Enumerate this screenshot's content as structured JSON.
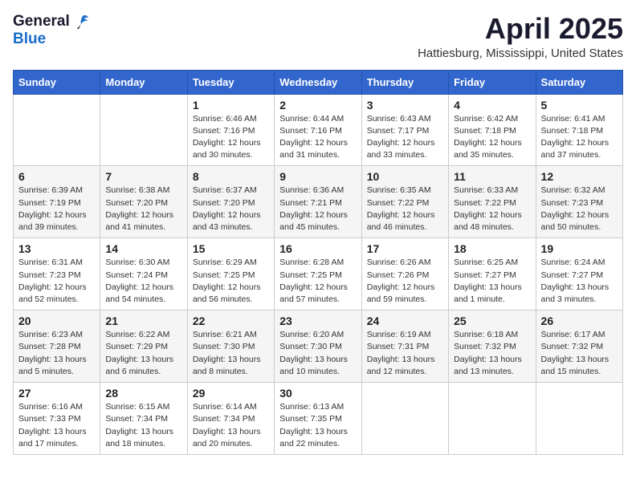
{
  "logo": {
    "general": "General",
    "blue": "Blue"
  },
  "title": "April 2025",
  "location": "Hattiesburg, Mississippi, United States",
  "days_of_week": [
    "Sunday",
    "Monday",
    "Tuesday",
    "Wednesday",
    "Thursday",
    "Friday",
    "Saturday"
  ],
  "weeks": [
    [
      {
        "day": "",
        "info": ""
      },
      {
        "day": "",
        "info": ""
      },
      {
        "day": "1",
        "info": "Sunrise: 6:46 AM\nSunset: 7:16 PM\nDaylight: 12 hours and 30 minutes."
      },
      {
        "day": "2",
        "info": "Sunrise: 6:44 AM\nSunset: 7:16 PM\nDaylight: 12 hours and 31 minutes."
      },
      {
        "day": "3",
        "info": "Sunrise: 6:43 AM\nSunset: 7:17 PM\nDaylight: 12 hours and 33 minutes."
      },
      {
        "day": "4",
        "info": "Sunrise: 6:42 AM\nSunset: 7:18 PM\nDaylight: 12 hours and 35 minutes."
      },
      {
        "day": "5",
        "info": "Sunrise: 6:41 AM\nSunset: 7:18 PM\nDaylight: 12 hours and 37 minutes."
      }
    ],
    [
      {
        "day": "6",
        "info": "Sunrise: 6:39 AM\nSunset: 7:19 PM\nDaylight: 12 hours and 39 minutes."
      },
      {
        "day": "7",
        "info": "Sunrise: 6:38 AM\nSunset: 7:20 PM\nDaylight: 12 hours and 41 minutes."
      },
      {
        "day": "8",
        "info": "Sunrise: 6:37 AM\nSunset: 7:20 PM\nDaylight: 12 hours and 43 minutes."
      },
      {
        "day": "9",
        "info": "Sunrise: 6:36 AM\nSunset: 7:21 PM\nDaylight: 12 hours and 45 minutes."
      },
      {
        "day": "10",
        "info": "Sunrise: 6:35 AM\nSunset: 7:22 PM\nDaylight: 12 hours and 46 minutes."
      },
      {
        "day": "11",
        "info": "Sunrise: 6:33 AM\nSunset: 7:22 PM\nDaylight: 12 hours and 48 minutes."
      },
      {
        "day": "12",
        "info": "Sunrise: 6:32 AM\nSunset: 7:23 PM\nDaylight: 12 hours and 50 minutes."
      }
    ],
    [
      {
        "day": "13",
        "info": "Sunrise: 6:31 AM\nSunset: 7:23 PM\nDaylight: 12 hours and 52 minutes."
      },
      {
        "day": "14",
        "info": "Sunrise: 6:30 AM\nSunset: 7:24 PM\nDaylight: 12 hours and 54 minutes."
      },
      {
        "day": "15",
        "info": "Sunrise: 6:29 AM\nSunset: 7:25 PM\nDaylight: 12 hours and 56 minutes."
      },
      {
        "day": "16",
        "info": "Sunrise: 6:28 AM\nSunset: 7:25 PM\nDaylight: 12 hours and 57 minutes."
      },
      {
        "day": "17",
        "info": "Sunrise: 6:26 AM\nSunset: 7:26 PM\nDaylight: 12 hours and 59 minutes."
      },
      {
        "day": "18",
        "info": "Sunrise: 6:25 AM\nSunset: 7:27 PM\nDaylight: 13 hours and 1 minute."
      },
      {
        "day": "19",
        "info": "Sunrise: 6:24 AM\nSunset: 7:27 PM\nDaylight: 13 hours and 3 minutes."
      }
    ],
    [
      {
        "day": "20",
        "info": "Sunrise: 6:23 AM\nSunset: 7:28 PM\nDaylight: 13 hours and 5 minutes."
      },
      {
        "day": "21",
        "info": "Sunrise: 6:22 AM\nSunset: 7:29 PM\nDaylight: 13 hours and 6 minutes."
      },
      {
        "day": "22",
        "info": "Sunrise: 6:21 AM\nSunset: 7:30 PM\nDaylight: 13 hours and 8 minutes."
      },
      {
        "day": "23",
        "info": "Sunrise: 6:20 AM\nSunset: 7:30 PM\nDaylight: 13 hours and 10 minutes."
      },
      {
        "day": "24",
        "info": "Sunrise: 6:19 AM\nSunset: 7:31 PM\nDaylight: 13 hours and 12 minutes."
      },
      {
        "day": "25",
        "info": "Sunrise: 6:18 AM\nSunset: 7:32 PM\nDaylight: 13 hours and 13 minutes."
      },
      {
        "day": "26",
        "info": "Sunrise: 6:17 AM\nSunset: 7:32 PM\nDaylight: 13 hours and 15 minutes."
      }
    ],
    [
      {
        "day": "27",
        "info": "Sunrise: 6:16 AM\nSunset: 7:33 PM\nDaylight: 13 hours and 17 minutes."
      },
      {
        "day": "28",
        "info": "Sunrise: 6:15 AM\nSunset: 7:34 PM\nDaylight: 13 hours and 18 minutes."
      },
      {
        "day": "29",
        "info": "Sunrise: 6:14 AM\nSunset: 7:34 PM\nDaylight: 13 hours and 20 minutes."
      },
      {
        "day": "30",
        "info": "Sunrise: 6:13 AM\nSunset: 7:35 PM\nDaylight: 13 hours and 22 minutes."
      },
      {
        "day": "",
        "info": ""
      },
      {
        "day": "",
        "info": ""
      },
      {
        "day": "",
        "info": ""
      }
    ]
  ]
}
